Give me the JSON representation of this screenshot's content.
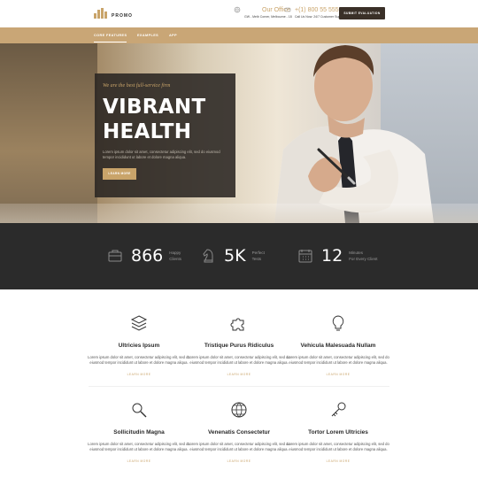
{
  "header": {
    "logo_text": "PROMO",
    "office": {
      "title": "Our Office",
      "subtitle": "GW - Melb Corner, Melbourne - 18"
    },
    "phone": {
      "title": "+(1) 800 55 555",
      "subtitle": "Call Us Now: 24/7 Customer Support"
    },
    "cta_label": "SUBMIT EVALUATION"
  },
  "nav": {
    "items": [
      {
        "label": "CORE FEATURES"
      },
      {
        "label": "EXAMPLES"
      },
      {
        "label": "APP"
      }
    ]
  },
  "hero": {
    "tagline": "We are the best full-service firm",
    "title_line1": "VIBRANT",
    "title_line2": "HEALTH",
    "text": "Lorem ipsum dolor sit amet, consectetur adipiscing elit, sed do eiusmod tempor incididunt ut labore et dolore magna aliqua.",
    "button_label": "LEARN MORE"
  },
  "stats": [
    {
      "icon": "briefcase-icon",
      "number": "866",
      "label1": "Happy",
      "label2": "Clients"
    },
    {
      "icon": "chess-knight-icon",
      "number": "5K",
      "label1": "Perfect",
      "label2": "Tests"
    },
    {
      "icon": "calendar-icon",
      "number": "12",
      "label1": "Minutes",
      "label2": "For Every Client"
    }
  ],
  "features": [
    {
      "icon": "layers-icon",
      "title": "Ultricies Ipsum",
      "text": "Lorem ipsum dolor sit amet, consectetur adipiscing elit, sed do eiusmod tempor incididunt ut labore et dolore magna aliqua.",
      "more": "LEARN MORE"
    },
    {
      "icon": "puzzle-icon",
      "title": "Tristique Purus Ridiculus",
      "text": "Lorem ipsum dolor sit amet, consectetur adipiscing elit, sed do eiusmod tempor incididunt ut labore et dolore magna aliqua.",
      "more": "LEARN MORE"
    },
    {
      "icon": "lightbulb-icon",
      "title": "Vehicula Malesuada Nullam",
      "text": "Lorem ipsum dolor sit amet, consectetur adipiscing elit, sed do eiusmod tempor incididunt ut labore et dolore magna aliqua.",
      "more": "LEARN MORE"
    },
    {
      "icon": "magnifier-icon",
      "title": "Sollicitudin Magna",
      "text": "Lorem ipsum dolor sit amet, consectetur adipiscing elit, sed do eiusmod tempor incididunt ut labore et dolore magna aliqua.",
      "more": "LEARN MORE"
    },
    {
      "icon": "globe-icon",
      "title": "Venenatis Consectetur",
      "text": "Lorem ipsum dolor sit amet, consectetur adipiscing elit, sed do eiusmod tempor incididunt ut labore et dolore magna aliqua.",
      "more": "LEARN MORE"
    },
    {
      "icon": "key-icon",
      "title": "Tortor Lorem Ultricies",
      "text": "Lorem ipsum dolor sit amet, consectetur adipiscing elit, sed do eiusmod tempor incididunt ut labore et dolore magna aliqua.",
      "more": "LEARN MORE"
    }
  ],
  "colors": {
    "accent": "#c9a46a",
    "nav_bg": "#c9a676",
    "stats_bg": "#2b2b2b",
    "cta_bg": "#3a3028"
  }
}
